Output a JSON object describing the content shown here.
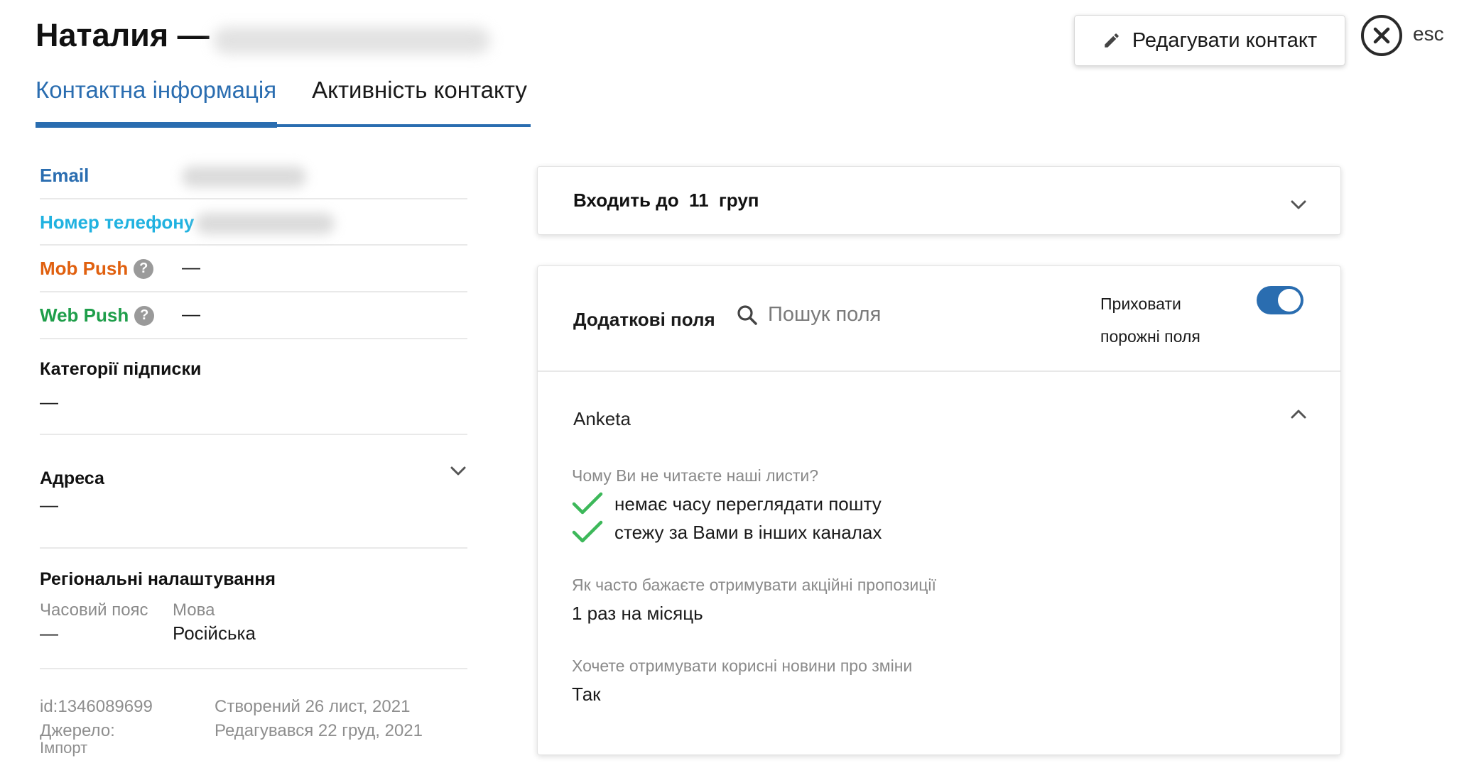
{
  "header": {
    "name": "Наталия —",
    "edit_button": "Редагувати контакт",
    "esc_label": "esc"
  },
  "tabs": [
    {
      "label": "Контактна інформація",
      "active": true
    },
    {
      "label": "Активність контакту",
      "active": false
    }
  ],
  "contact": {
    "email_label": "Email",
    "phone_label": "Номер телефону",
    "mob_push_label": "Mob Push",
    "mob_push_value": "—",
    "web_push_label": "Web Push",
    "web_push_value": "—",
    "help_glyph": "?",
    "subscription_categories_title": "Категорії підписки",
    "subscription_categories_value": "—",
    "address_title": "Адреса",
    "address_value": "—",
    "regional_title": "Регіональні налаштування",
    "timezone_label": "Часовий пояс",
    "timezone_value": "—",
    "language_label": "Мова",
    "language_value": "Російська",
    "id": "id:1346089699",
    "source_label": "Джерело:",
    "source_value": "Імпорт",
    "created": "Створений 26 лист, 2021",
    "edited": "Редагувався 22 груд, 2021"
  },
  "groups_card": {
    "text": "Входить до  11  груп"
  },
  "extra_fields": {
    "title": "Додаткові поля",
    "search_placeholder": "Пошук поля",
    "hide_empty_line1": "Приховати",
    "hide_empty_line2": "порожні поля",
    "hide_empty_enabled": true,
    "section": "Anketa",
    "q1": "Чому Ви не читаєте наші листи?",
    "q1_answers": [
      "немає часу переглядати пошту",
      "стежу за Вами в інших каналах"
    ],
    "q2": "Як часто бажаєте отримувати акційні пропозиції",
    "q2_answer": "1 раз на місяць",
    "q3": "Хочете отримувати корисні новини про зміни",
    "q3_answer": "Так"
  },
  "colors": {
    "accent": "#2a6db0",
    "email_label": "#2a6db0",
    "phone_label": "#20b2e0",
    "mob_push": "#e0600f",
    "web_push": "#1e9e4a",
    "check": "#3db85a"
  }
}
